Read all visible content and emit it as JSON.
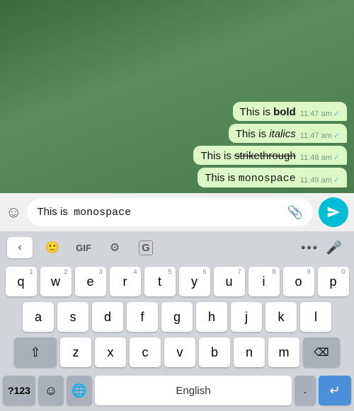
{
  "chat": {
    "messages": [
      {
        "id": 1,
        "text_before": "This is ",
        "bold": "bold",
        "text_after": "",
        "format": "bold",
        "time": "11:47 am",
        "checked": true
      },
      {
        "id": 2,
        "text_before": "This is ",
        "italic": "italics",
        "text_after": "",
        "format": "italic",
        "time": "11:47 am",
        "checked": true
      },
      {
        "id": 3,
        "text_before": "This is ",
        "strikethrough": "strikethrough",
        "text_after": "",
        "format": "strikethrough",
        "time": "11:48 am",
        "checked": true
      },
      {
        "id": 4,
        "text_before": "This is ",
        "mono": "monospace",
        "text_after": "",
        "format": "mono",
        "time": "11:49 am",
        "checked": true
      }
    ]
  },
  "input": {
    "text_before": "This is  ",
    "mono_text": "monospace",
    "emoji_icon": "☺",
    "paperclip_icon": "🖇",
    "send_icon": "send"
  },
  "keyboard_topbar": {
    "back_icon": "‹",
    "sticker_icon": "🙂",
    "gif_label": "GIF",
    "settings_icon": "⚙",
    "translate_icon": "G",
    "dots_icon": "...",
    "mic_icon": "🎤"
  },
  "keyboard_rows": {
    "row1": [
      {
        "key": "q",
        "num": "1"
      },
      {
        "key": "w",
        "num": "2"
      },
      {
        "key": "e",
        "num": "3"
      },
      {
        "key": "r",
        "num": "4"
      },
      {
        "key": "t",
        "num": "5"
      },
      {
        "key": "y",
        "num": "6"
      },
      {
        "key": "u",
        "num": "7"
      },
      {
        "key": "i",
        "num": "8"
      },
      {
        "key": "o",
        "num": "9"
      },
      {
        "key": "p",
        "num": "0"
      }
    ],
    "row2": [
      {
        "key": "a"
      },
      {
        "key": "s"
      },
      {
        "key": "d"
      },
      {
        "key": "f"
      },
      {
        "key": "g"
      },
      {
        "key": "h"
      },
      {
        "key": "j"
      },
      {
        "key": "k"
      },
      {
        "key": "l"
      }
    ],
    "row3": [
      {
        "key": "shift",
        "special": true
      },
      {
        "key": "z"
      },
      {
        "key": "x"
      },
      {
        "key": "c"
      },
      {
        "key": "v"
      },
      {
        "key": "b"
      },
      {
        "key": "n"
      },
      {
        "key": "m"
      },
      {
        "key": "⌫",
        "special": true
      }
    ]
  },
  "keyboard_bottom": {
    "num_label": "?123",
    "comma_label": ",",
    "globe_icon": "🌐",
    "space_label": "English",
    "period_label": ".",
    "enter_icon": "↵"
  }
}
